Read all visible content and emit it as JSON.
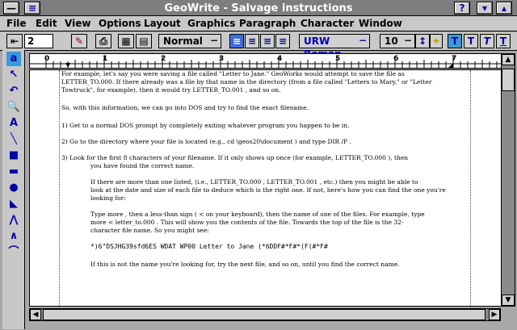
{
  "window": {
    "title": "GeoWrite - Salvage instructions",
    "help": "?"
  },
  "menu": [
    "File",
    "Edit",
    "View",
    "Options",
    "Layout",
    "Graphics",
    "Paragraph",
    "Character",
    "Window"
  ],
  "toolbar": {
    "page_number": "2",
    "paragraph_style": "Normal",
    "font": "URW Roman",
    "font_size": "10"
  },
  "ruler": {
    "marks": [
      "0",
      "1",
      "2",
      "3",
      "4",
      "5",
      "6",
      "7"
    ]
  },
  "document": {
    "lines": [
      {
        "t": "For example, let's say you were saving a file called \"Letter to Jane.\" GeoWorks would attempt to save the file as"
      },
      {
        "t": "LETTER_TO.000.  If there already was a file by that name in the directory (from a file called \"Letters to Mary,\" or \"Letter"
      },
      {
        "t": "Towtruck\", for example), then it would try  LETTER_TO.001 , and so on."
      },
      {
        "t": "So, with this information, we can go into DOS and try to find the exact filename."
      },
      {
        "t": "1)          Get to a normal DOS prompt by completely exiting whatever program you happen to be in."
      },
      {
        "t": "2)          Go to the directory where your file is located (e.g.,   cd  \\geos20\\document   ) and type  DIR /P ."
      },
      {
        "t": "3)          Look for the first 8 characters of your filename. If it only shows up once (for example, LETTER_TO.000 ), then"
      },
      {
        "t": "you have found the correct name."
      },
      {
        "t": "If there are more than one listed, (i.e.,   LETTER_TO.000 ,  LETTER_TO.001 , etc.) then you might be able to"
      },
      {
        "t": "look at the date and size of each file to deduce which is the right one.  If not, here's how you can find the one you're"
      },
      {
        "t": "looking for:"
      },
      {
        "t": "Type  more , then a less-than sign ( < on your keyboard), then the name of one of the files.  For example, type"
      },
      {
        "t": "more  < letter_to.000  .  This will show you the contents of the file.  Towards the top of the file is the 32-"
      },
      {
        "t": "character file name.  So you might see:"
      },
      {
        "t": "*)6\"DSJHG39sfd6ES WDAT WP00 Letter to Jane (*6DDF#*F#*(F(#*F#"
      },
      {
        "t": "If this is not the name you're looking for, try the next file, and so on, until you find the correct name."
      }
    ]
  }
}
